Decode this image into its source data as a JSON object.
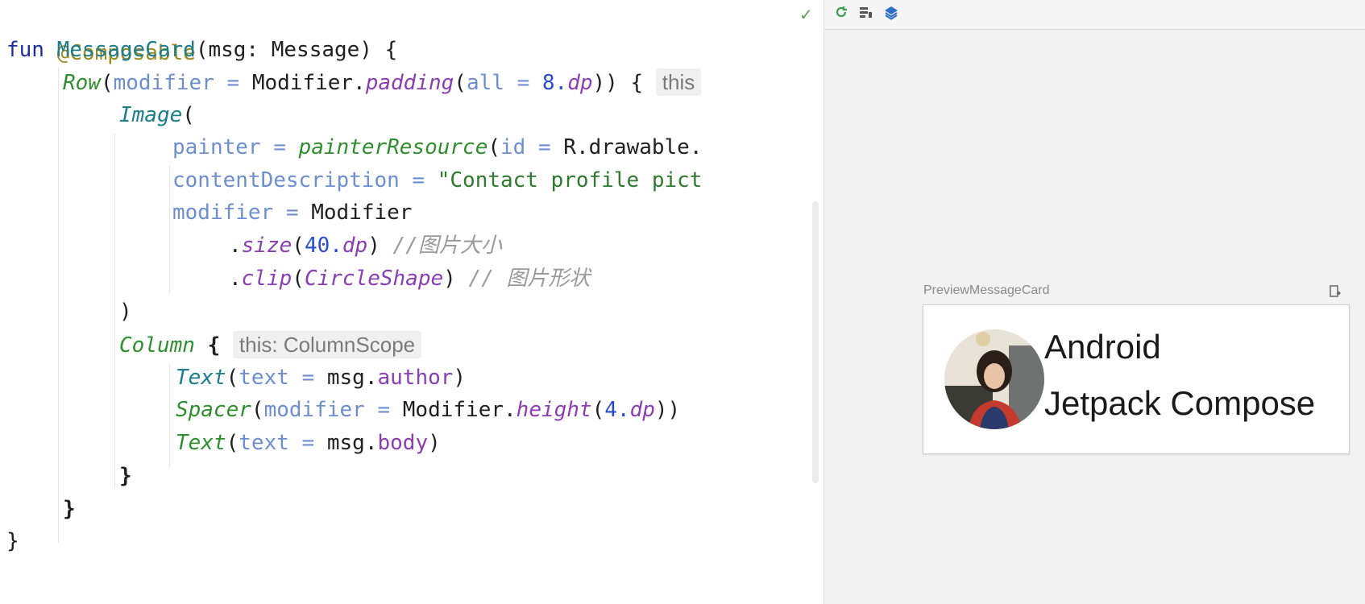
{
  "editor": {
    "status_check": "✓",
    "lines": {
      "l1": {
        "annotation": "@Composable"
      },
      "l2": {
        "kw": "fun",
        "name": "MessageCard",
        "params": "(msg: Message) {"
      },
      "l3": {
        "call": "Row",
        "open": "(",
        "param": "modifier",
        "eq": " = ",
        "obj": "Modifier.",
        "ext": "padding",
        "open2": "(",
        "param2": "all",
        "eq2": " = ",
        "num": "8.",
        "unit": "dp",
        "close": ")) {",
        "hint": "this"
      },
      "l4": {
        "call": "Image",
        "open": "("
      },
      "l5": {
        "param": "painter",
        "eq": " = ",
        "call": "painterResource",
        "open": "(",
        "param2": "id",
        "eq2": " = ",
        "rest": "R.drawable."
      },
      "l6": {
        "param": "contentDescription",
        "eq": " = ",
        "str": "\"Contact profile pict"
      },
      "l7": {
        "param": "modifier",
        "eq": " = ",
        "obj": "Modifier"
      },
      "l8": {
        "dot": ".",
        "ext": "size",
        "open": "(",
        "num": "40.",
        "unit": "dp",
        "close": ")",
        "cmt": " //图片大小"
      },
      "l9": {
        "dot": ".",
        "ext": "clip",
        "open": "(",
        "shape": "CircleShape",
        "close": ")",
        "cmt": " // 图片形状"
      },
      "l10": {
        "text": ")"
      },
      "l11": {
        "call": "Column",
        "brace": " {",
        "hint": "this: ColumnScope"
      },
      "l12": {
        "call": "Text",
        "open": "(",
        "param": "text",
        "eq": " = ",
        "obj": "msg.",
        "prop": "author",
        "close": ")"
      },
      "l13": {
        "call": "Spacer",
        "open": "(",
        "param": "modifier",
        "eq": " = ",
        "obj": "Modifier.",
        "ext": "height",
        "open2": "(",
        "num": "4.",
        "unit": "dp",
        "close": "))"
      },
      "l14": {
        "call": "Text",
        "open": "(",
        "param": "text",
        "eq": " = ",
        "obj": "msg.",
        "prop": "body",
        "close": ")"
      },
      "l15": {
        "text": "}"
      },
      "l16": {
        "text": "}"
      },
      "l17": {
        "text": "}"
      }
    }
  },
  "preview": {
    "toolbar_icons": [
      "refresh-icon",
      "layout-icon",
      "layers-icon"
    ],
    "label": "PreviewMessageCard",
    "card": {
      "author": "Android",
      "body": "Jetpack Compose"
    }
  },
  "colors": {
    "keyword": "#1c2fa0",
    "annotation": "#9a8a22",
    "function_call": "#2f8f2f",
    "parameter": "#6d8ed0",
    "number": "#2a4bd0",
    "extension": "#8b3db3",
    "string": "#2f7a2f",
    "comment": "#9a9a9a"
  }
}
